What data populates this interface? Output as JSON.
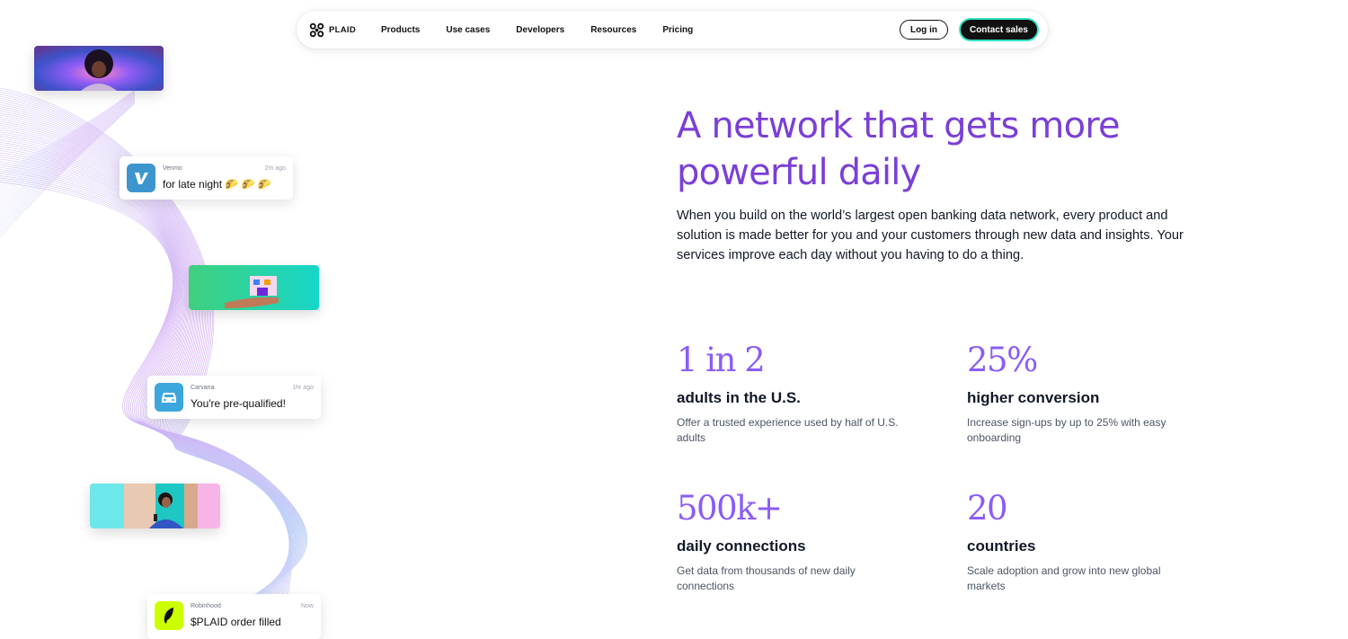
{
  "nav": {
    "logo_text": "PLAID",
    "links": [
      "Products",
      "Use cases",
      "Developers",
      "Resources",
      "Pricing"
    ],
    "login_label": "Log in",
    "contact_label": "Contact sales"
  },
  "notifications": [
    {
      "app": "Venmo",
      "time": "2m ago",
      "message": "for late night 🌮 🌮 🌮",
      "icon": "venmo-icon",
      "color": "#3d95ce"
    },
    {
      "app": "Carvana",
      "time": "1hr ago",
      "message": "You're pre-qualified!",
      "icon": "car-icon",
      "color": "#3da6dd"
    },
    {
      "app": "Robinhood",
      "time": "Now",
      "message": "$PLAID order filled",
      "icon": "feather-icon",
      "color": "#ccff00"
    }
  ],
  "hero": {
    "headline": "A network that gets more powerful daily",
    "intro": "When you build on the world’s largest open banking data network, every product and solution is made better for you and your customers through new data and insights. Your services improve each day without you having to do a thing."
  },
  "stats": [
    {
      "value": "1 in 2",
      "label": "adults in the U.S.",
      "desc": "Offer a trusted experience used by half of U.S. adults"
    },
    {
      "value": "25%",
      "label": "higher conversion",
      "desc": "Increase sign-ups by up to 25% with easy onboarding"
    },
    {
      "value": "500k+",
      "label": "daily connections",
      "desc": "Get data from thousands of new daily connections"
    },
    {
      "value": "20",
      "label": "countries",
      "desc": "Scale adoption and grow into new global markets"
    }
  ],
  "colors": {
    "headline": "#7b3fd6",
    "stat_number": "#8b5cf6",
    "accent_outline": "#34e3c4"
  }
}
